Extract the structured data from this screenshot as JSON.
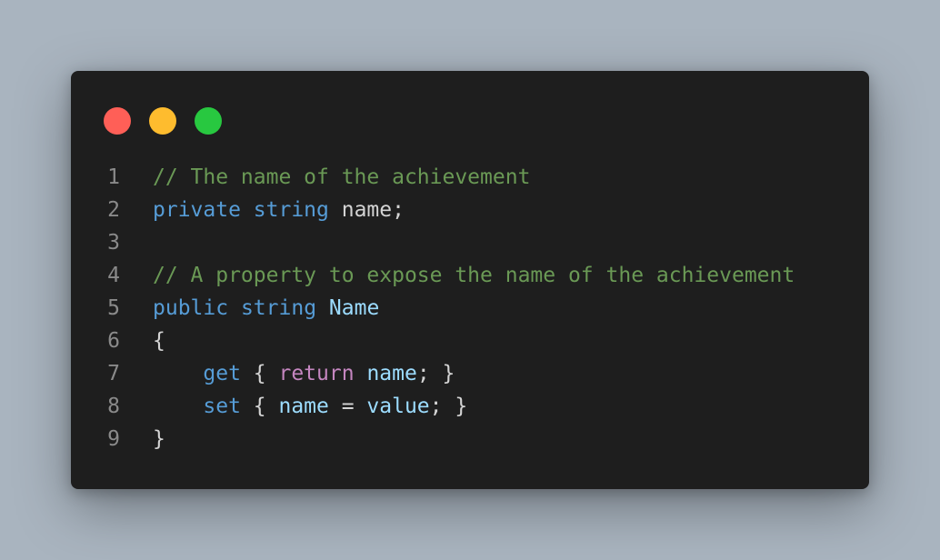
{
  "window": {
    "controls": [
      {
        "name": "close",
        "color": "#ff5f57"
      },
      {
        "name": "minimize",
        "color": "#febc2e"
      },
      {
        "name": "maximize",
        "color": "#28c840"
      }
    ]
  },
  "code": {
    "language": "csharp",
    "lines": [
      {
        "number": "1",
        "tokens": [
          {
            "t": "// The name of the achievement",
            "k": "comment"
          }
        ]
      },
      {
        "number": "2",
        "tokens": [
          {
            "t": "private",
            "k": "kw"
          },
          {
            "t": " ",
            "k": "plain"
          },
          {
            "t": "string",
            "k": "kw"
          },
          {
            "t": " name;",
            "k": "plain"
          }
        ]
      },
      {
        "number": "3",
        "tokens": []
      },
      {
        "number": "4",
        "tokens": [
          {
            "t": "// A property to expose the name of the achievement",
            "k": "comment"
          }
        ]
      },
      {
        "number": "5",
        "tokens": [
          {
            "t": "public",
            "k": "kw"
          },
          {
            "t": " ",
            "k": "plain"
          },
          {
            "t": "string",
            "k": "kw"
          },
          {
            "t": " ",
            "k": "plain"
          },
          {
            "t": "Name",
            "k": "ident"
          }
        ]
      },
      {
        "number": "6",
        "tokens": [
          {
            "t": "{",
            "k": "plain"
          }
        ]
      },
      {
        "number": "7",
        "tokens": [
          {
            "t": "    ",
            "k": "plain"
          },
          {
            "t": "get",
            "k": "kw"
          },
          {
            "t": " { ",
            "k": "plain"
          },
          {
            "t": "return",
            "k": "ctrl"
          },
          {
            "t": " ",
            "k": "plain"
          },
          {
            "t": "name",
            "k": "ident"
          },
          {
            "t": "; }",
            "k": "plain"
          }
        ]
      },
      {
        "number": "8",
        "tokens": [
          {
            "t": "    ",
            "k": "plain"
          },
          {
            "t": "set",
            "k": "kw"
          },
          {
            "t": " { ",
            "k": "plain"
          },
          {
            "t": "name",
            "k": "ident"
          },
          {
            "t": " = ",
            "k": "plain"
          },
          {
            "t": "value",
            "k": "ident"
          },
          {
            "t": "; }",
            "k": "plain"
          }
        ]
      },
      {
        "number": "9",
        "tokens": [
          {
            "t": "}",
            "k": "plain"
          }
        ]
      }
    ]
  }
}
